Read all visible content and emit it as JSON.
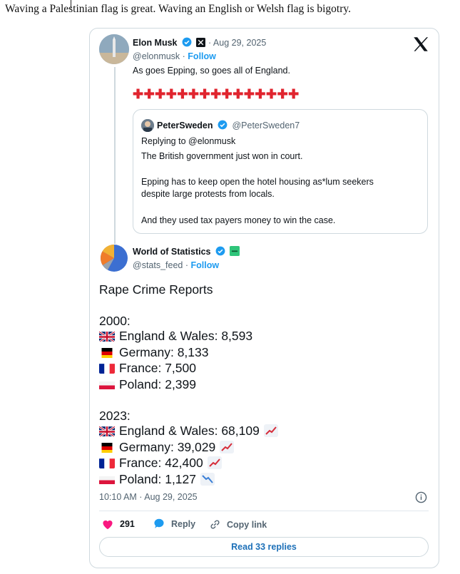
{
  "caption": "Waving a Palestinian flag is great. Waving an English or Welsh flag is bigotry.",
  "tweet": {
    "author_name": "Elon Musk",
    "handle": "@elonmusk",
    "date": "Aug 29, 2025",
    "follow_label": "Follow",
    "text": "As goes Epping, so goes all of England.",
    "crosses": "✚✚✚✚✚✚✚✚✚✚✚✚✚✚✚",
    "platform_icon": "x-logo-icon"
  },
  "quoted": {
    "author_name": "PeterSweden",
    "handle": "@PeterSweden7",
    "replying_to": "Replying to @elonmusk",
    "lines": [
      "The British government just won in court.",
      "Epping has to keep open the hotel housing as*lum seekers",
      "despite large protests from locals.",
      "And they used tax payers money to win the case."
    ]
  },
  "reply": {
    "author_name": "World of Statistics",
    "handle": "@stats_feed",
    "follow_label": "Follow",
    "title": "Rape Crime Reports",
    "year_2000": "2000:",
    "year_2023": "2023:",
    "rows_2000": [
      {
        "country": "England & Wales",
        "value": "8,593",
        "flag": "uk"
      },
      {
        "country": "Germany",
        "value": "8,133",
        "flag": "de"
      },
      {
        "country": "France",
        "value": "7,500",
        "flag": "fr"
      },
      {
        "country": "Poland",
        "value": "2,399",
        "flag": "pl"
      }
    ],
    "rows_2023": [
      {
        "country": "England & Wales",
        "value": "68,109",
        "flag": "uk",
        "trend": "up"
      },
      {
        "country": "Germany",
        "value": "39,029",
        "flag": "de",
        "trend": "up"
      },
      {
        "country": "France",
        "value": "42,400",
        "flag": "fr",
        "trend": "up"
      },
      {
        "country": "Poland",
        "value": "1,127",
        "flag": "pl",
        "trend": "down"
      }
    ],
    "timestamp": "10:10 AM · Aug 29, 2025"
  },
  "actions": {
    "likes": "291",
    "reply_label": "Reply",
    "copy_label": "Copy link",
    "read_replies": "Read 33 replies"
  },
  "colors": {
    "accent": "#1d9bf0",
    "like": "#f91880",
    "cross": "#e0242e"
  }
}
